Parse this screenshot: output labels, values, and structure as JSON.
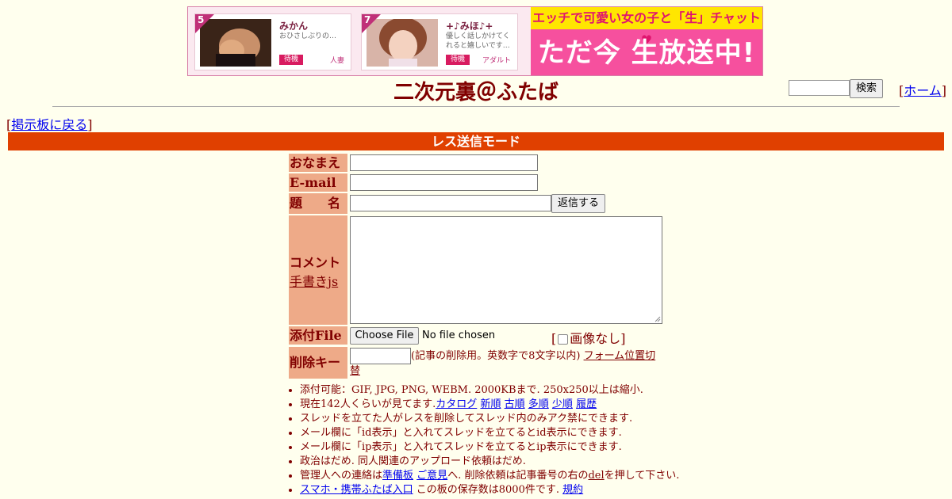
{
  "banner": {
    "cards": [
      {
        "rank": "5",
        "name": "みかん",
        "desc": "おひさしぶりの…",
        "status": "待機",
        "category": "人妻"
      },
      {
        "rank": "7",
        "name": "+♪みほ♪+",
        "desc": "優しく話しかけてくれると嬉しいです…",
        "status": "待機",
        "category": "アダルト"
      }
    ],
    "live_top": "エッチで可愛い女の子と「生」チャット♥",
    "live_main": "ただ今 生放送中!"
  },
  "header": {
    "title": "二次元裏＠ふたば",
    "search_button": "検索",
    "bracket_open": "[",
    "home_link": "ホーム",
    "bracket_close": "]"
  },
  "nav": {
    "bracket_open": "[",
    "back_link": "掲示板に戻る",
    "bracket_close": "]"
  },
  "mode_bar": "レス送信モード",
  "form": {
    "name_label": "おなまえ",
    "email_label": "E-mail",
    "subject_label": "題　　名",
    "submit_button": "返信する",
    "comment_label": "コメント",
    "draw_link": "手書きjs",
    "file_label": "添付File",
    "choose_file": "Choose File",
    "no_file": "No file chosen",
    "noimg_open": "[",
    "noimg_label": "画像なし",
    "noimg_close": "]",
    "delkey_label": "削除キー",
    "delkey_note": "(記事の削除用。英数字で8文字以内)",
    "form_pos_link": "フォーム位置切替"
  },
  "rules": {
    "r1": "添付可能：GIF, JPG, PNG, WEBM. 2000KBまで. 250x250以上は縮小.",
    "r2_prefix": "現在142人くらいが見てます.",
    "r2_links": [
      "カタログ",
      "新順",
      "古順",
      "多順",
      "少順",
      "履歴"
    ],
    "r3": "スレッドを立てた人がレスを削除してスレッド内のみアク禁にできます.",
    "r4": "メール欄に「id表示」と入れてスレッドを立てるとid表示にできます.",
    "r5": "メール欄に「ip表示」と入れてスレッドを立てるとip表示にできます.",
    "r6": "政治はだめ. 同人関連のアップロード依頼はだめ.",
    "r7_prefix": "管理人への連絡は",
    "r7_link1": "準備板",
    "r7_link2": "ご意見",
    "r7_mid": "へ. 削除依頼は記事番号の右の",
    "r7_del": "del",
    "r7_suffix": "を押して下さい.",
    "r8_link": "スマホ・携帯ふたば入口",
    "r8_mid": " この板の保存数は8000件です. ",
    "r8_rules": "規約"
  }
}
